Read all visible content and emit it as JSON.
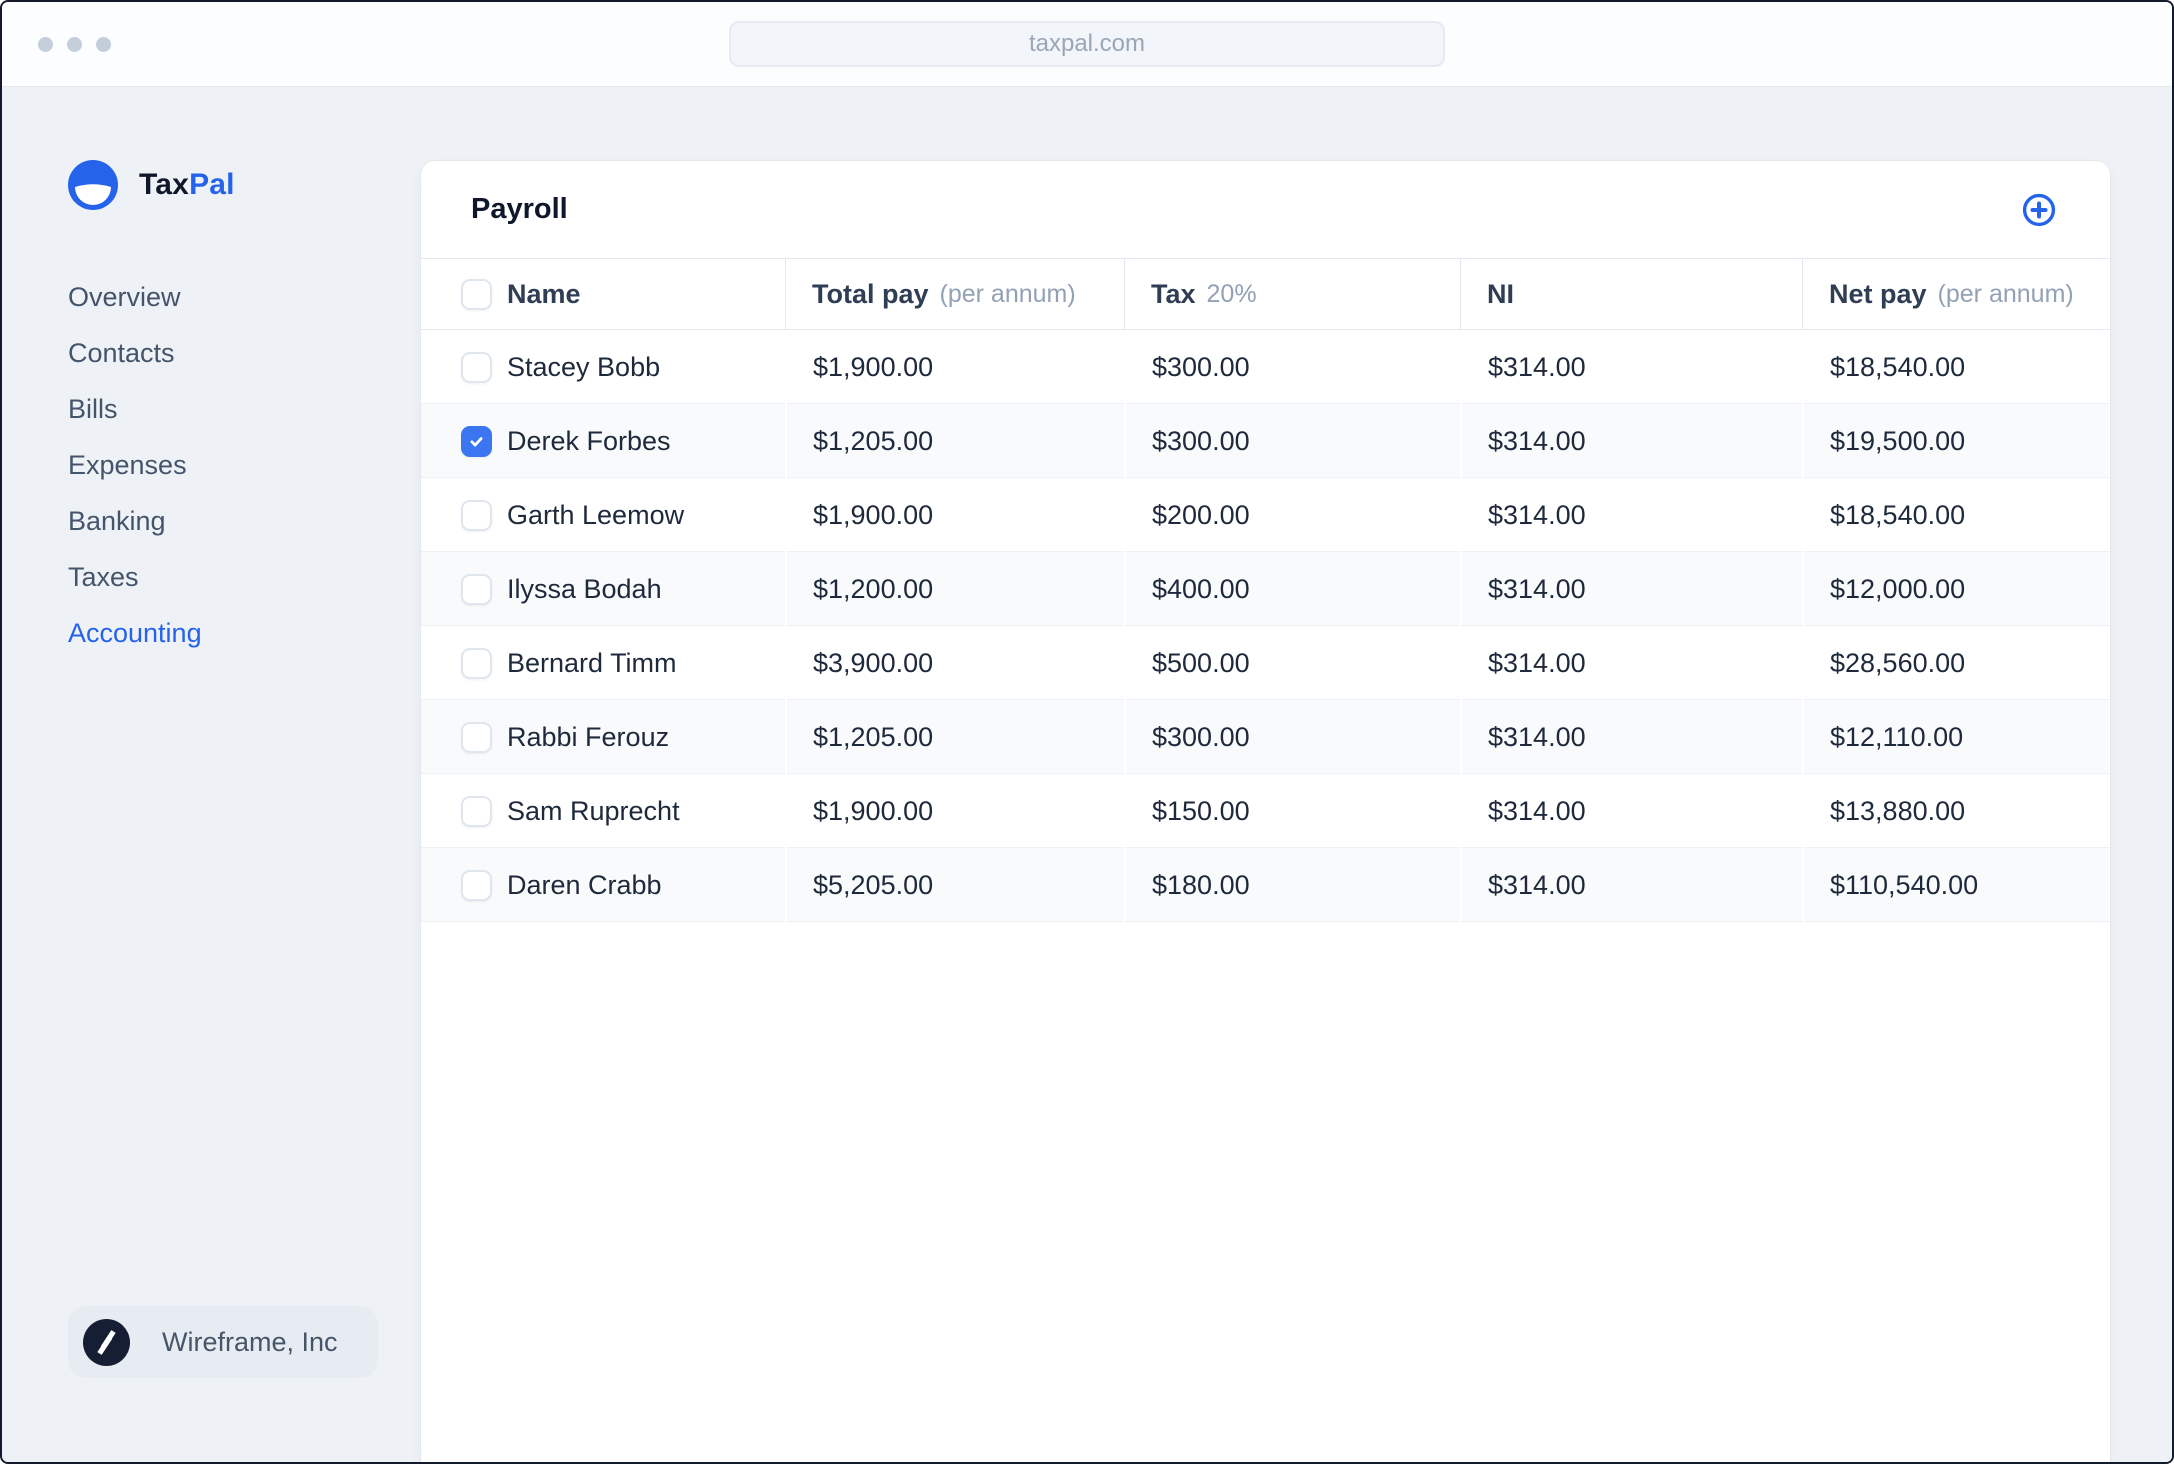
{
  "browser": {
    "url": "taxpal.com"
  },
  "sidebar": {
    "brand": {
      "primary": "Tax",
      "secondary": "Pal"
    },
    "items": [
      {
        "label": "Overview",
        "active": false
      },
      {
        "label": "Contacts",
        "active": false
      },
      {
        "label": "Bills",
        "active": false
      },
      {
        "label": "Expenses",
        "active": false
      },
      {
        "label": "Banking",
        "active": false
      },
      {
        "label": "Taxes",
        "active": false
      },
      {
        "label": "Accounting",
        "active": true
      }
    ],
    "company": "Wireframe, Inc"
  },
  "payroll": {
    "title": "Payroll",
    "columns": [
      {
        "label": "Name",
        "suffix": ""
      },
      {
        "label": "Total pay",
        "suffix": "(per annum)"
      },
      {
        "label": "Tax",
        "suffix": "20%"
      },
      {
        "label": "NI",
        "suffix": ""
      },
      {
        "label": "Net pay",
        "suffix": "(per annum)"
      }
    ],
    "rows": [
      {
        "name": "Stacey Bobb",
        "total_pay": "$1,900.00",
        "tax": "$300.00",
        "ni": "$314.00",
        "net_pay": "$18,540.00",
        "checked": false
      },
      {
        "name": "Derek Forbes",
        "total_pay": "$1,205.00",
        "tax": "$300.00",
        "ni": "$314.00",
        "net_pay": "$19,500.00",
        "checked": true
      },
      {
        "name": "Garth Leemow",
        "total_pay": "$1,900.00",
        "tax": "$200.00",
        "ni": "$314.00",
        "net_pay": "$18,540.00",
        "checked": false
      },
      {
        "name": "Ilyssa Bodah",
        "total_pay": "$1,200.00",
        "tax": "$400.00",
        "ni": "$314.00",
        "net_pay": "$12,000.00",
        "checked": false
      },
      {
        "name": "Bernard Timm",
        "total_pay": "$3,900.00",
        "tax": "$500.00",
        "ni": "$314.00",
        "net_pay": "$28,560.00",
        "checked": false
      },
      {
        "name": "Rabbi Ferouz",
        "total_pay": "$1,205.00",
        "tax": "$300.00",
        "ni": "$314.00",
        "net_pay": "$12,110.00",
        "checked": false
      },
      {
        "name": "Sam Ruprecht",
        "total_pay": "$1,900.00",
        "tax": "$150.00",
        "ni": "$314.00",
        "net_pay": "$13,880.00",
        "checked": false
      },
      {
        "name": "Daren Crabb",
        "total_pay": "$5,205.00",
        "tax": "$180.00",
        "ni": "$314.00",
        "net_pay": "$110,540.00",
        "checked": false
      }
    ]
  },
  "colors": {
    "accent_blue": "#2563eb",
    "checkbox_checked": "#3b76f0",
    "page_background": "#eef2f7",
    "stripe": "#f8fafc"
  }
}
